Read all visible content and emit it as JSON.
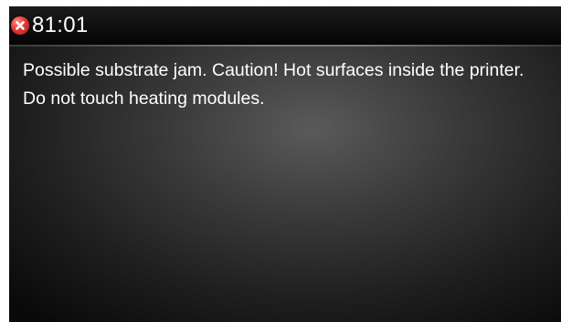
{
  "title_bar": {
    "icon": "error-icon",
    "code": "81:01"
  },
  "message": {
    "text": "Possible substrate jam. Caution! Hot surfaces inside the printer. Do not touch heating modules."
  },
  "colors": {
    "error_icon": "#e53935",
    "text": "#ffffff",
    "background": "#000000"
  }
}
